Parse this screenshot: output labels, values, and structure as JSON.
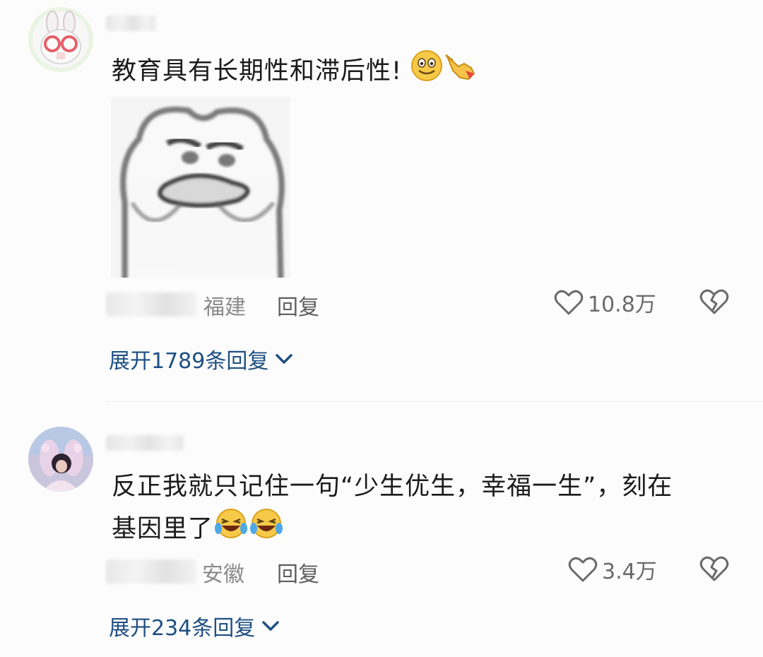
{
  "comments": [
    {
      "text": "教育具有长期性和滞后性!",
      "location": "福建",
      "reply_label": "回复",
      "likes": "10.8万",
      "expand_label": "展开1789条回复",
      "emojis": [
        "smile-emoji",
        "pointing-hand-emoji"
      ],
      "has_sticker": true
    },
    {
      "text_line1": "反正我就只记住一句“少生优生，幸福一生”，刻在",
      "text_line2": "基因里了",
      "location": "安徽",
      "reply_label": "回复",
      "likes": "3.4万",
      "expand_label": "展开234条回复",
      "emojis": [
        "laugh-cry-emoji",
        "laugh-cry-emoji"
      ]
    }
  ],
  "icons": {
    "like": "heart-outline-icon",
    "dislike": "broken-heart-icon",
    "expand": "chevron-down-icon"
  },
  "colors": {
    "background": "#fcfcfc",
    "link_blue": "#1e4f82",
    "meta_gray": "#8a8a8a"
  }
}
